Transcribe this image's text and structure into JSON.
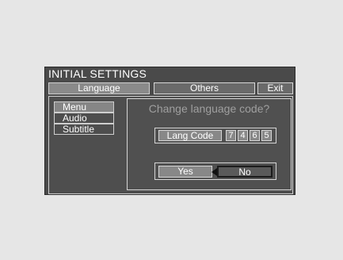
{
  "screen": {
    "title": "INITIAL SETTINGS"
  },
  "tabs": [
    {
      "label": "Language"
    },
    {
      "label": "Others"
    },
    {
      "label": "Exit"
    }
  ],
  "left_menu": {
    "items": [
      {
        "label": "Menu"
      },
      {
        "label": "Audio"
      },
      {
        "label": "Subtitle"
      }
    ]
  },
  "dialog": {
    "title": "Change language code?",
    "code_label": "Lang Code",
    "digits": [
      "7",
      "4",
      "6",
      "5"
    ],
    "yes_label": "Yes",
    "no_label": "No",
    "cursor_icon": "left-pointer-triangle"
  }
}
